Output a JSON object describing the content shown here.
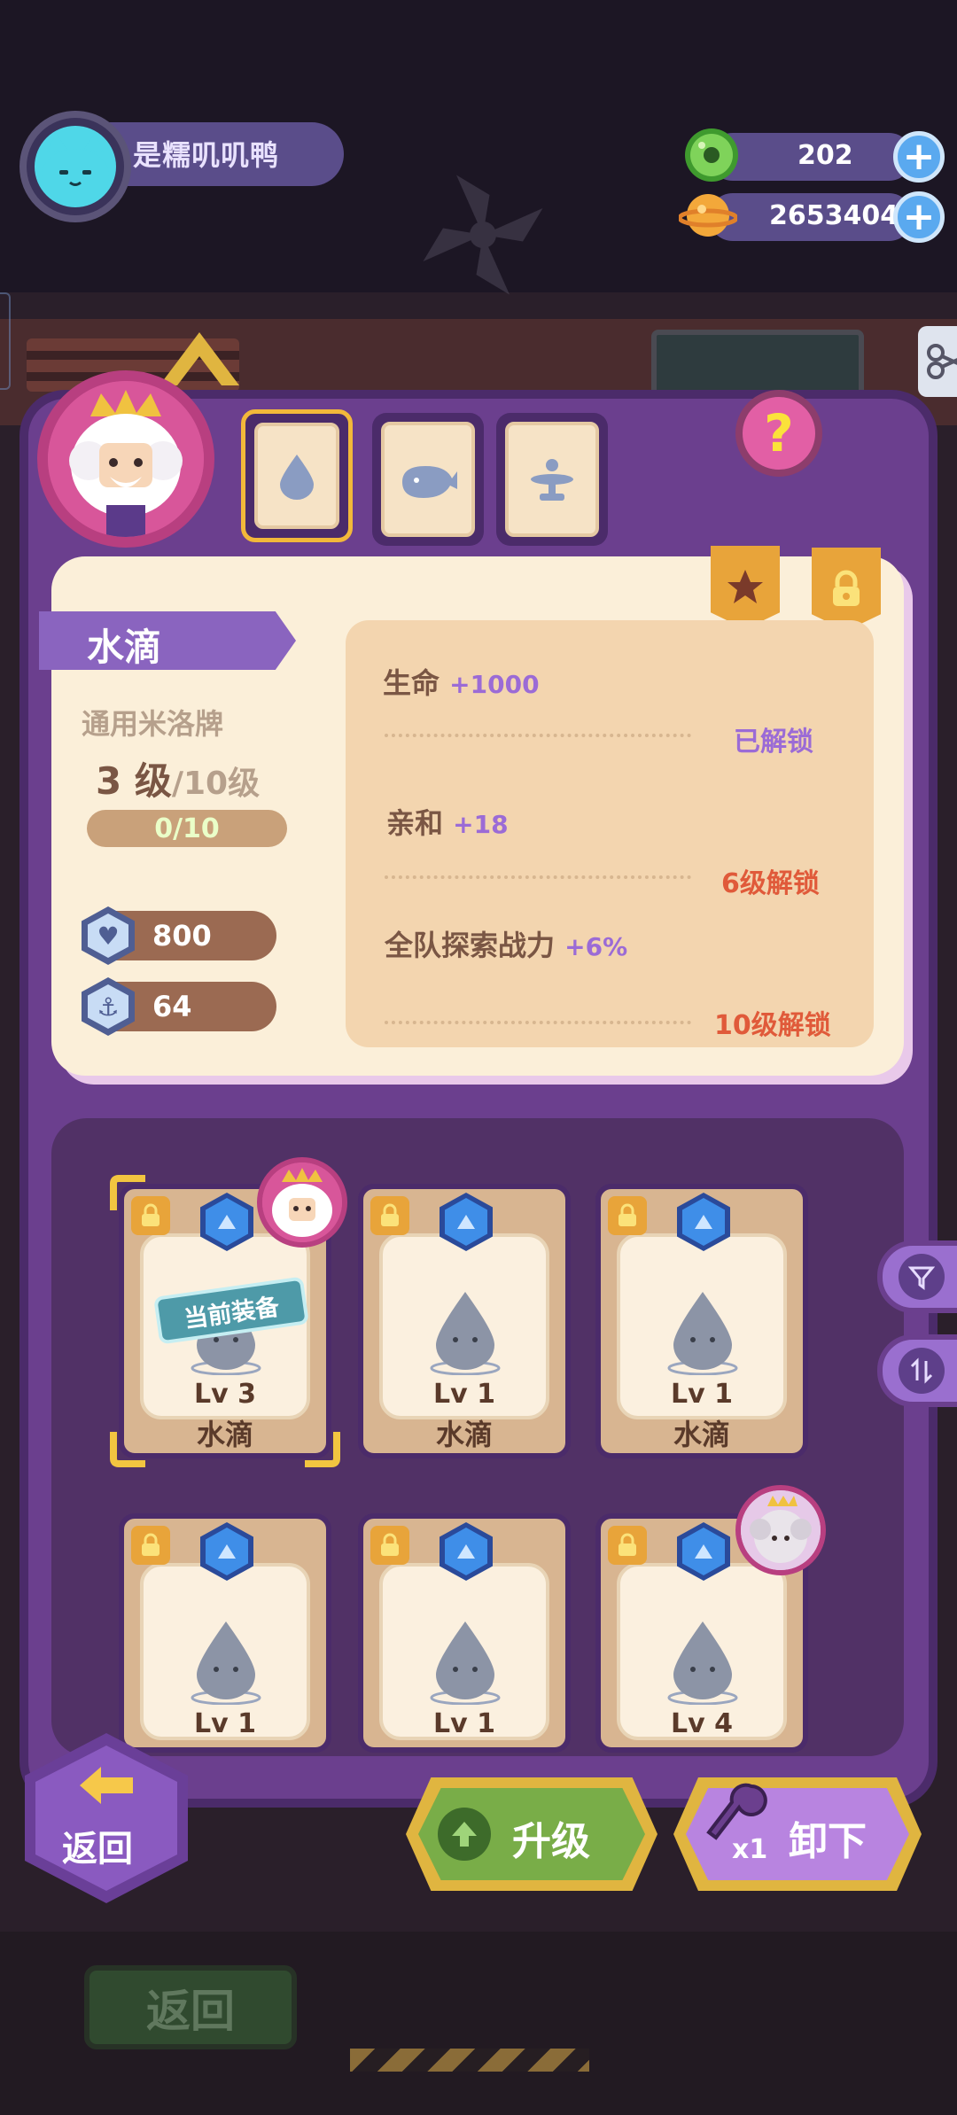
{
  "player": {
    "name": "是糯叽叽鸭",
    "avatar_icon": "cat-face-icon"
  },
  "currencies": [
    {
      "icon": "donut-gem-icon",
      "value": "202",
      "color": "#5cc24a"
    },
    {
      "icon": "planet-coin-icon",
      "value": "2653404",
      "color": "#f3a83a"
    }
  ],
  "tabs": [
    {
      "icon": "water-drop-icon",
      "active": true
    },
    {
      "icon": "whale-icon",
      "active": false
    },
    {
      "icon": "fountain-icon",
      "active": false
    }
  ],
  "help_label": "?",
  "item": {
    "name": "水滴",
    "type": "通用米洛牌",
    "level_current": "3 级",
    "level_max": "/10级",
    "exp": "0/10",
    "stats": [
      {
        "icon": "heart-shield-icon",
        "value": "800"
      },
      {
        "icon": "anchor-shield-icon",
        "value": "64"
      }
    ]
  },
  "attributes": [
    {
      "name": "生命",
      "bonus": "+1000",
      "status": "已解锁",
      "unlocked": true
    },
    {
      "name": "亲和",
      "bonus": "+18",
      "status": "6级解锁",
      "unlocked": false
    },
    {
      "name": "全队探索战力",
      "bonus": "+6%",
      "status": "10级解锁",
      "unlocked": false
    }
  ],
  "badges": [
    "star-icon",
    "lock-icon"
  ],
  "equip_tag": "当前装备",
  "cards": [
    {
      "lv_label": "Lv",
      "level": "3",
      "name": "水滴",
      "equipped": true
    },
    {
      "lv_label": "Lv",
      "level": "1",
      "name": "水滴",
      "equipped": false
    },
    {
      "lv_label": "Lv",
      "level": "1",
      "name": "水滴",
      "equipped": false
    },
    {
      "lv_label": "Lv",
      "level": "1",
      "name": "",
      "equipped": false
    },
    {
      "lv_label": "Lv",
      "level": "1",
      "name": "",
      "equipped": false
    },
    {
      "lv_label": "Lv",
      "level": "4",
      "name": "",
      "equipped": false
    }
  ],
  "side_buttons": [
    "filter-icon",
    "sort-icon"
  ],
  "actions": {
    "back": "返回",
    "upgrade": "升级",
    "unequip": "卸下",
    "unequip_count": "x1"
  },
  "background": {
    "back_text": "返回"
  }
}
